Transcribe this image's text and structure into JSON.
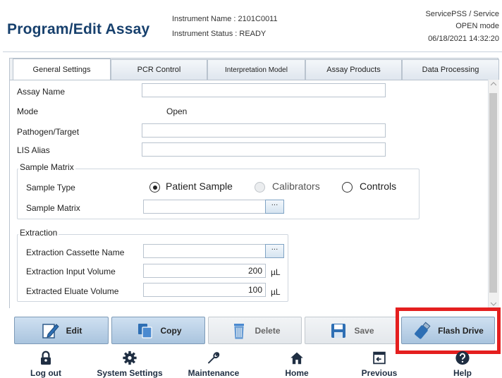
{
  "header": {
    "title": "Program/Edit Assay",
    "instrument_name": "Instrument Name : 2101C0011",
    "instrument_status": "Instrument Status : READY",
    "user": "ServicePSS / Service",
    "mode": "OPEN mode",
    "datetime": "06/18/2021 14:32:20"
  },
  "tabs": [
    "General Settings",
    "PCR Control",
    "Interpretation Model",
    "Assay Products",
    "Data Processing"
  ],
  "form": {
    "assay_name_label": "Assay Name",
    "assay_name_value": "",
    "mode_label": "Mode",
    "mode_value": "Open",
    "pathogen_label": "Pathogen/Target",
    "pathogen_value": "",
    "lis_label": "LIS Alias",
    "lis_value": "",
    "sample_matrix_group": "Sample Matrix",
    "sample_type_label": "Sample Type",
    "sample_type_options": [
      "Patient Sample",
      "Calibrators",
      "Controls"
    ],
    "sample_type_selected": "Patient Sample",
    "sample_matrix_label": "Sample Matrix",
    "sample_matrix_value": "",
    "extraction_group": "Extraction",
    "cassette_label": "Extraction Cassette Name",
    "cassette_value": "",
    "input_volume_label": "Extraction Input Volume",
    "input_volume_value": "200",
    "eluate_volume_label": "Extracted Eluate Volume",
    "eluate_volume_value": "100",
    "unit": "µL",
    "ellipsis": "···"
  },
  "actions": {
    "edit": "Edit",
    "copy": "Copy",
    "delete": "Delete",
    "save": "Save",
    "flash_drive": "Flash Drive"
  },
  "nav": {
    "logout": "Log out",
    "system_settings": "System Settings",
    "maintenance": "Maintenance",
    "home": "Home",
    "previous": "Previous",
    "help": "Help"
  },
  "icons": {
    "edit": "pencil-icon",
    "copy": "copy-icon",
    "delete": "trash-icon",
    "save": "floppy-icon",
    "flash_drive": "usb-drive-icon",
    "logout": "lock-icon",
    "system_settings": "gear-icon",
    "maintenance": "wrench-icon",
    "home": "home-icon",
    "previous": "previous-icon",
    "help": "help-icon"
  },
  "colors": {
    "title": "#17406d",
    "button": "#a9c4de",
    "highlight": "#e41f1f",
    "nav_icon": "#1f2e42"
  }
}
